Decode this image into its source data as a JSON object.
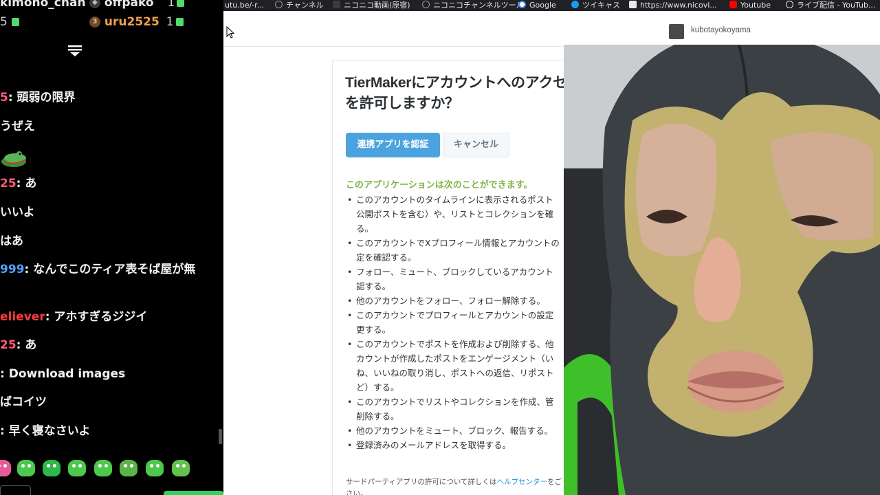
{
  "chat": {
    "top_users": [
      {
        "name": "kimono_chan",
        "count": "",
        "rank": ""
      },
      {
        "name": "offpako",
        "count": "1",
        "rank": ""
      },
      {
        "name": "",
        "count": "5",
        "rank": ""
      },
      {
        "name": "uru2525",
        "count": "1",
        "rank": "3"
      }
    ],
    "messages": [
      {
        "name": "5",
        "name_color": "#ff5a7a",
        "text": ": 頭弱の限界"
      },
      {
        "name": "",
        "name_color": "#ffffff",
        "text": "うぜえ"
      },
      {
        "name": "25",
        "name_color": "#ff5a7a",
        "text": ": あ"
      },
      {
        "name": "",
        "name_color": "#ffffff",
        "text": "いいよ"
      },
      {
        "name": "",
        "name_color": "#ffffff",
        "text": "はあ"
      },
      {
        "name": "999",
        "name_color": "#4ea0ff",
        "text": ": なんでこのティア表そば屋が無"
      },
      {
        "name": "eliever",
        "name_color": "#ff3b3b",
        "text": ": アホすぎるジジイ"
      },
      {
        "name": "25",
        "name_color": "#ff5a7a",
        "text": ": あ"
      },
      {
        "name": "",
        "name_color": "#4ea0ff",
        "text": ": Download images"
      },
      {
        "name": "",
        "name_color": "#ffffff",
        "text": "ばコイツ"
      },
      {
        "name": "",
        "name_color": "#4ea0ff",
        "text": ": 早く寝なさいよ"
      }
    ],
    "colors": {
      "gift": "#53d86a",
      "emote": "#4cc94c",
      "send": "#2fd35a"
    }
  },
  "browser": {
    "bookmarks": [
      {
        "label": "utu.be/-r...",
        "icon": "youtube-icon",
        "color": "transparent"
      },
      {
        "label": "チャンネル",
        "icon": "niconico-channel-icon",
        "color": "#9a9a9a"
      },
      {
        "label": "ニコニコ動画(原宿)",
        "icon": "niconico-icon",
        "color": "#3c3c3c"
      },
      {
        "label": "ニコニコチャンネルツール",
        "icon": "niconico-channel-icon",
        "color": "#9a9a9a"
      },
      {
        "label": "Google",
        "icon": "google-icon",
        "color": "#4285f4"
      },
      {
        "label": "ツイキャス",
        "icon": "twitcasting-icon",
        "color": "#1d9bf0"
      },
      {
        "label": "https://www.nicovi...",
        "icon": "mail-icon",
        "color": "#e8e8e8"
      },
      {
        "label": "Youtube",
        "icon": "youtube-icon",
        "color": "#ff0000"
      },
      {
        "label": "ライブ配信 - YouTub...",
        "icon": "globe-icon",
        "color": "#e8e8e8"
      }
    ],
    "header": {
      "username": "kubotayokoyama"
    },
    "auth": {
      "title_line1": "TierMakerにアカウントへのアクセ",
      "title_line2": "を許可しますか？",
      "authorize_label": "連携アプリを認証",
      "cancel_label": "キャンセル",
      "permissions_heading": "このアプリケーションは次のことができます。",
      "permissions": [
        [
          "このアカウントのタイムラインに表示されるポスト",
          "公開ポストを含む）や、リストとコレクションを確",
          "る。"
        ],
        [
          "このアカウントでXプロフィール情報とアカウントの",
          "定を確認する。"
        ],
        [
          "フォロー、ミュート、ブロックしているアカウント",
          "認する。"
        ],
        [
          "他のアカウントをフォロー、フォロー解除する。"
        ],
        [
          "このアカウントでプロフィールとアカウントの設定",
          "更する。"
        ],
        [
          "このアカウントでポストを作成および削除する、他",
          "カウントが作成したポストをエンゲージメント（い",
          "ね、いいねの取り消し、ポストへの返信、リポスト",
          "ど）する。"
        ],
        [
          "このアカウントでリストやコレクションを作成、管",
          "削除する。"
        ],
        [
          "他のアカウントをミュート、ブロック、報告する。"
        ],
        [
          "登録済みのメールアドレスを取得する。"
        ]
      ],
      "learn_more_prefix": "サードパーティアプリの許可について詳しくは",
      "learn_more_link": "ヘルプセンター",
      "learn_more_suffix": "をご",
      "learn_more_line2": "さい。"
    },
    "colors": {
      "authorize": "#4aa3df",
      "heading_green": "#7cb342",
      "link": "#1b95e0"
    }
  }
}
